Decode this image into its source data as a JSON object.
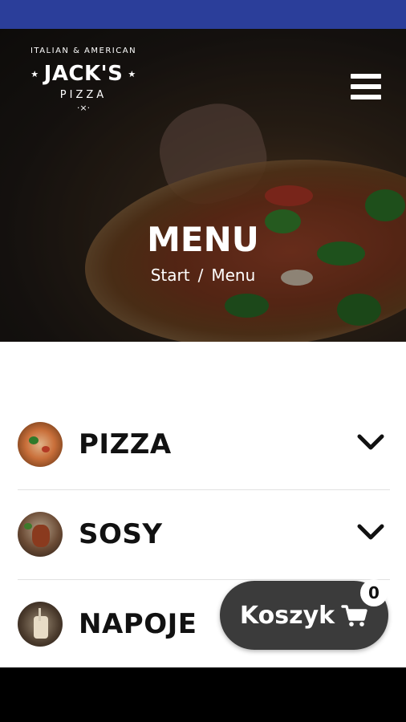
{
  "logo": {
    "top_text": "ITALIAN & AMERICAN",
    "name": "JACK'S",
    "sub_text": "PIZZA",
    "mark": "·×·"
  },
  "hero": {
    "title": "MENU",
    "breadcrumb": {
      "home": "Start",
      "separator": "/",
      "current": "Menu"
    }
  },
  "categories": [
    {
      "label": "PIZZA",
      "icon": "pizza-thumbnail"
    },
    {
      "label": "SOSY",
      "icon": "sauce-thumbnail"
    },
    {
      "label": "NAPOJE",
      "icon": "drink-thumbnail"
    }
  ],
  "cart": {
    "label": "Koszyk",
    "count": "0",
    "icon": "cart-icon"
  },
  "colors": {
    "status_bar": "#2b3e9a",
    "cart_button": "#3b3b3b"
  }
}
